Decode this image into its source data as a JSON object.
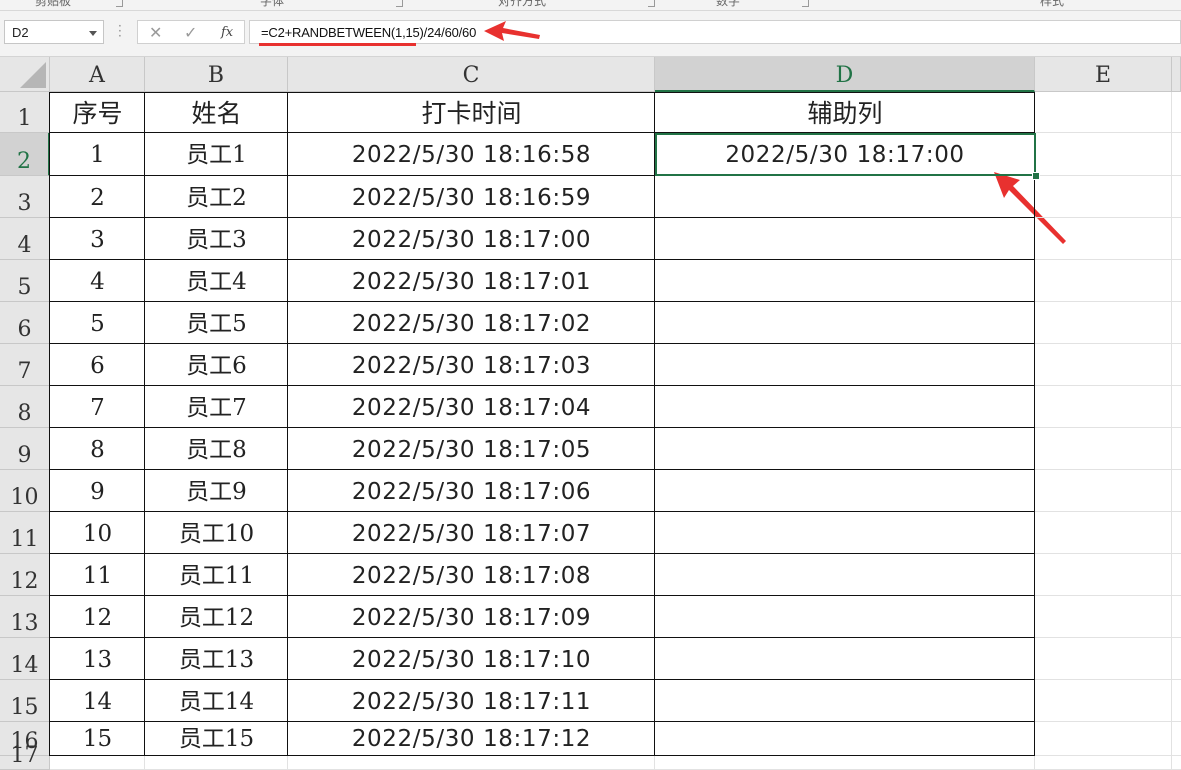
{
  "ribbon": {
    "group_labels": [
      "剪贴板",
      "字体",
      "对齐方式",
      "数字",
      "样式"
    ]
  },
  "formula_bar": {
    "name_box": "D2",
    "cancel_icon": "✕",
    "enter_icon": "✓",
    "fx_label": "fx",
    "formula": "=C2+RANDBETWEEN(1,15)/24/60/60"
  },
  "columns": [
    "A",
    "B",
    "C",
    "D",
    "E"
  ],
  "row_numbers": [
    "1",
    "2",
    "3",
    "4",
    "5",
    "6",
    "7",
    "8",
    "9",
    "10",
    "11",
    "12",
    "13",
    "14",
    "15",
    "16",
    "17"
  ],
  "table": {
    "headers": [
      "序号",
      "姓名",
      "打卡时间",
      "辅助列"
    ],
    "rows": [
      [
        "1",
        "员工1",
        "2022/5/30  18:16:58",
        "2022/5/30  18:17:00"
      ],
      [
        "2",
        "员工2",
        "2022/5/30  18:16:59",
        ""
      ],
      [
        "3",
        "员工3",
        "2022/5/30  18:17:00",
        ""
      ],
      [
        "4",
        "员工4",
        "2022/5/30  18:17:01",
        ""
      ],
      [
        "5",
        "员工5",
        "2022/5/30  18:17:02",
        ""
      ],
      [
        "6",
        "员工6",
        "2022/5/30  18:17:03",
        ""
      ],
      [
        "7",
        "员工7",
        "2022/5/30  18:17:04",
        ""
      ],
      [
        "8",
        "员工8",
        "2022/5/30  18:17:05",
        ""
      ],
      [
        "9",
        "员工9",
        "2022/5/30  18:17:06",
        ""
      ],
      [
        "10",
        "员工10",
        "2022/5/30  18:17:07",
        ""
      ],
      [
        "11",
        "员工11",
        "2022/5/30  18:17:08",
        ""
      ],
      [
        "12",
        "员工12",
        "2022/5/30  18:17:09",
        ""
      ],
      [
        "13",
        "员工13",
        "2022/5/30  18:17:10",
        ""
      ],
      [
        "14",
        "员工14",
        "2022/5/30  18:17:11",
        ""
      ],
      [
        "15",
        "员工15",
        "2022/5/30  18:17:12",
        ""
      ]
    ]
  },
  "selection": {
    "cell": "D2"
  },
  "colors": {
    "accent_green": "#217346",
    "annotation_red": "#e8312f",
    "header_bg": "#e6e6e6"
  }
}
